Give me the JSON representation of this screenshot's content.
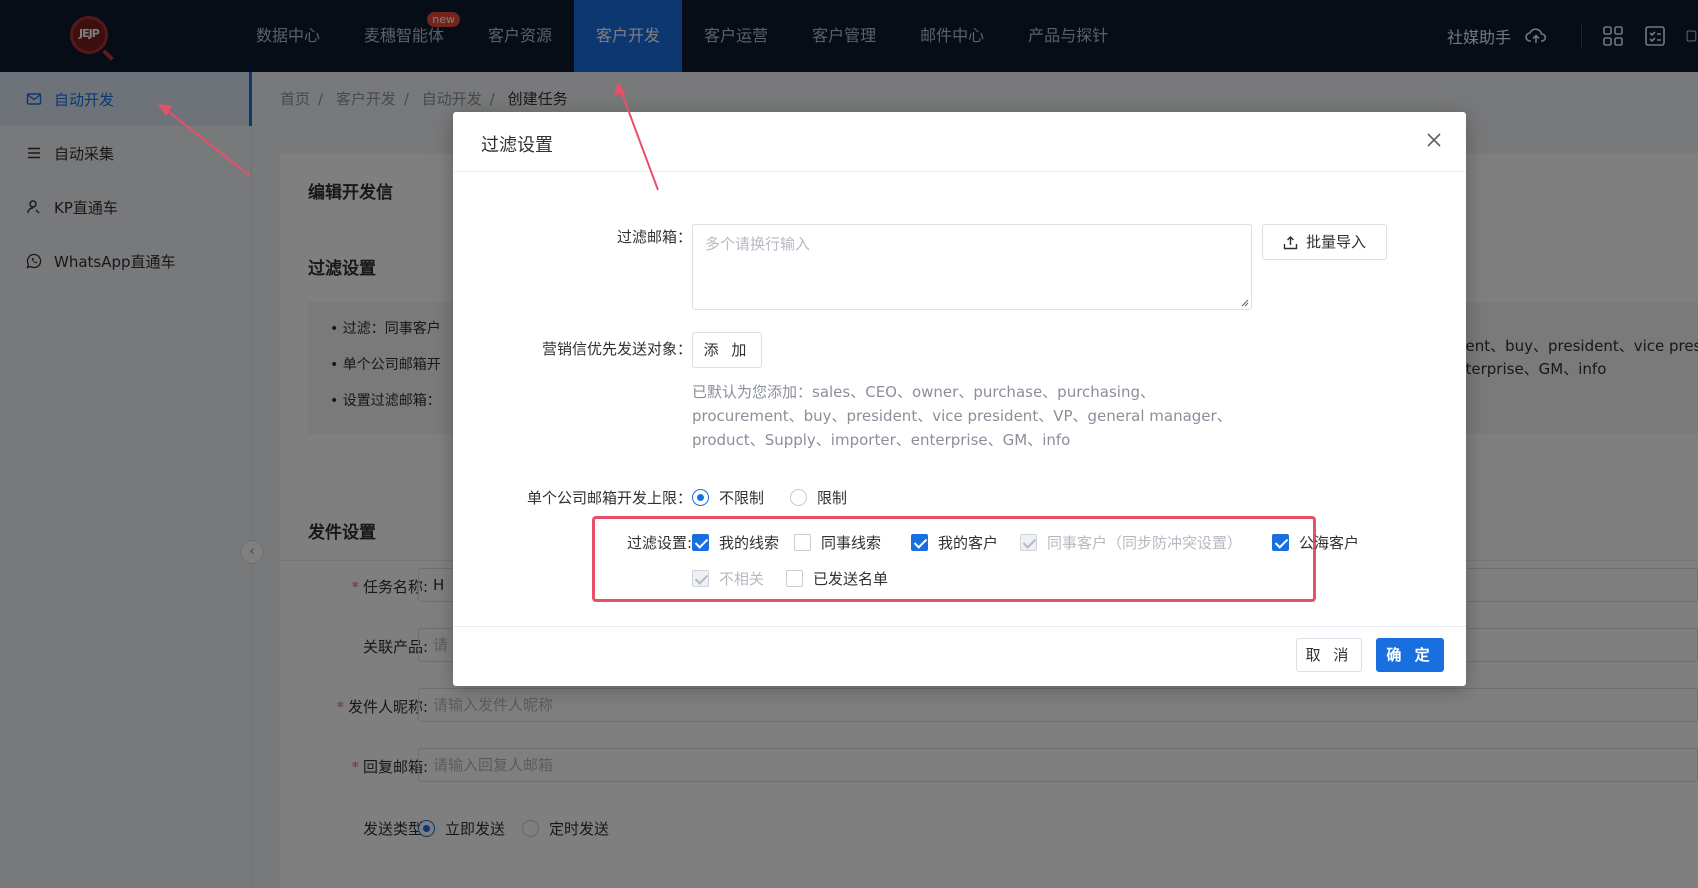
{
  "topbar": {
    "logo_text": "JEJP",
    "nav": [
      {
        "label": "数据中心",
        "active": false,
        "badge": ""
      },
      {
        "label": "麦穗智能体",
        "active": false,
        "badge": "new"
      },
      {
        "label": "客户资源",
        "active": false,
        "badge": ""
      },
      {
        "label": "客户开发",
        "active": true,
        "badge": ""
      },
      {
        "label": "客户运营",
        "active": false,
        "badge": ""
      },
      {
        "label": "客户管理",
        "active": false,
        "badge": ""
      },
      {
        "label": "邮件中心",
        "active": false,
        "badge": ""
      },
      {
        "label": "产品与探针",
        "active": false,
        "badge": ""
      }
    ],
    "assistant_label": "社媒助手",
    "icons": [
      "cloud-upload-icon",
      "grid-apps-icon",
      "checklist-icon",
      "more-icon"
    ]
  },
  "sidebar": {
    "items": [
      {
        "label": "自动开发",
        "icon": "mail-icon",
        "active": true
      },
      {
        "label": "自动采集",
        "icon": "list-icon",
        "active": false
      },
      {
        "label": "KP直通车",
        "icon": "user-search-icon",
        "active": false
      },
      {
        "label": "WhatsApp直通车",
        "icon": "whatsapp-icon",
        "active": false
      }
    ],
    "collapse_glyph": "‹"
  },
  "breadcrumb": [
    "首页",
    "客户开发",
    "自动开发",
    "创建任务"
  ],
  "page": {
    "edit_title": "编辑开发信",
    "filter_title": "过滤设置",
    "info_lines": [
      "• 过滤：同事客户",
      "• 单个公司邮箱开",
      "• 设置过滤邮箱："
    ],
    "info_right_1": "nent、buy、president、vice presi",
    "info_right_2": "nterprise、GM、info",
    "send_title": "发件设置",
    "task_name_label": "任务名称:",
    "task_name_value": "H",
    "product_label": "关联产品:",
    "product_value": "请",
    "sender_label": "发件人昵称:",
    "sender_placeholder": "请输入发件人昵称",
    "reply_label": "回复邮箱:",
    "reply_placeholder": "请输入回复人邮箱",
    "send_type_label": "发送类型:",
    "send_now": "立即发送",
    "send_scheduled": "定时发送"
  },
  "modal": {
    "title": "过滤设置",
    "filter_email_label": "过滤邮箱：",
    "filter_email_placeholder": "多个请换行输入",
    "import_button": "批量导入",
    "priority_label": "营销信优先发送对象：",
    "add_button": "添 加",
    "default_text": "已默认为您添加：sales、CEO、owner、purchase、purchasing、procurement、buy、president、vice president、VP、general manager、product、Supply、importer、enterprise、GM、info",
    "limit_label": "单个公司邮箱开发上限：",
    "limit_options": [
      {
        "label": "不限制",
        "selected": true
      },
      {
        "label": "限制",
        "selected": false
      }
    ],
    "filter_label": "过滤设置:",
    "filter_options": [
      {
        "label": "我的线索",
        "checked": true,
        "disabled": false
      },
      {
        "label": "同事线索",
        "checked": false,
        "disabled": false
      },
      {
        "label": "我的客户",
        "checked": true,
        "disabled": false
      },
      {
        "label": "同事客户（同步防冲突设置）",
        "checked": true,
        "disabled": true
      },
      {
        "label": "公海客户",
        "checked": true,
        "disabled": false
      },
      {
        "label": "不相关",
        "checked": true,
        "disabled": true
      },
      {
        "label": "已发送名单",
        "checked": false,
        "disabled": false
      }
    ],
    "cancel_button": "取 消",
    "confirm_button": "确 定"
  },
  "colors": {
    "topbar": "#0c1a2e",
    "accent": "#1a6fe0",
    "highlight": "#e8506a",
    "badge": "#e8473b"
  }
}
